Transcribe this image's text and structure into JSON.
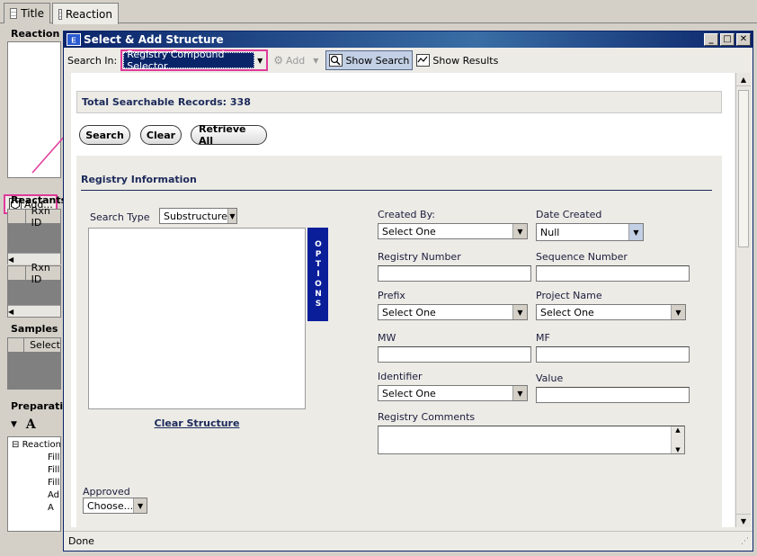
{
  "tabs": [
    {
      "label": "Title"
    },
    {
      "label": "Reaction"
    }
  ],
  "left": {
    "reaction_header": "Reaction",
    "add_label": "Add...",
    "reactants_header": "Reactants",
    "rxn_col": "Rxn ID",
    "rxn_col2": "Rxn ID",
    "samples_header": "Samples",
    "select_col": "Select",
    "preparation_header": "Preparation",
    "font_glyph": "A",
    "tree": [
      "Reaction",
      "Fill",
      "Fill",
      "Fill",
      "Ad",
      "A"
    ]
  },
  "dialog": {
    "title": "Select & Add Structure",
    "toolbar": {
      "search_in_label": "Search In:",
      "search_in_value": "Registry Compound Selector",
      "add_label": "Add",
      "show_search": "Show Search",
      "show_results": "Show Results"
    },
    "total_records": "Total Searchable Records: 338",
    "buttons": {
      "search": "Search",
      "clear": "Clear",
      "retrieve_all": "Retrieve All"
    },
    "section_title": "Registry Information",
    "search_type_label": "Search Type",
    "search_type_value": "Substructure",
    "options_label": "OPTIONS",
    "clear_structure": "Clear Structure",
    "approved_label": "Approved",
    "approved_value": "Choose...",
    "fields": {
      "created_by": {
        "label": "Created By:",
        "value": "Select One"
      },
      "date_created": {
        "label": "Date Created",
        "value": "Null"
      },
      "registry_number": {
        "label": "Registry Number"
      },
      "sequence_number": {
        "label": "Sequence Number"
      },
      "prefix": {
        "label": "Prefix",
        "value": "Select One"
      },
      "project_name": {
        "label": "Project Name",
        "value": "Select One"
      },
      "mw": {
        "label": "MW"
      },
      "mf": {
        "label": "MF"
      },
      "identifier": {
        "label": "Identifier",
        "value": "Select One"
      },
      "value": {
        "label": "Value"
      },
      "registry_comments": {
        "label": "Registry Comments"
      }
    },
    "status": "Done"
  },
  "colors": {
    "highlight": "#e03a9a",
    "title_bar": "#0a246a",
    "options_tab": "#0a1e9a",
    "section_title": "#1c2a5a"
  }
}
